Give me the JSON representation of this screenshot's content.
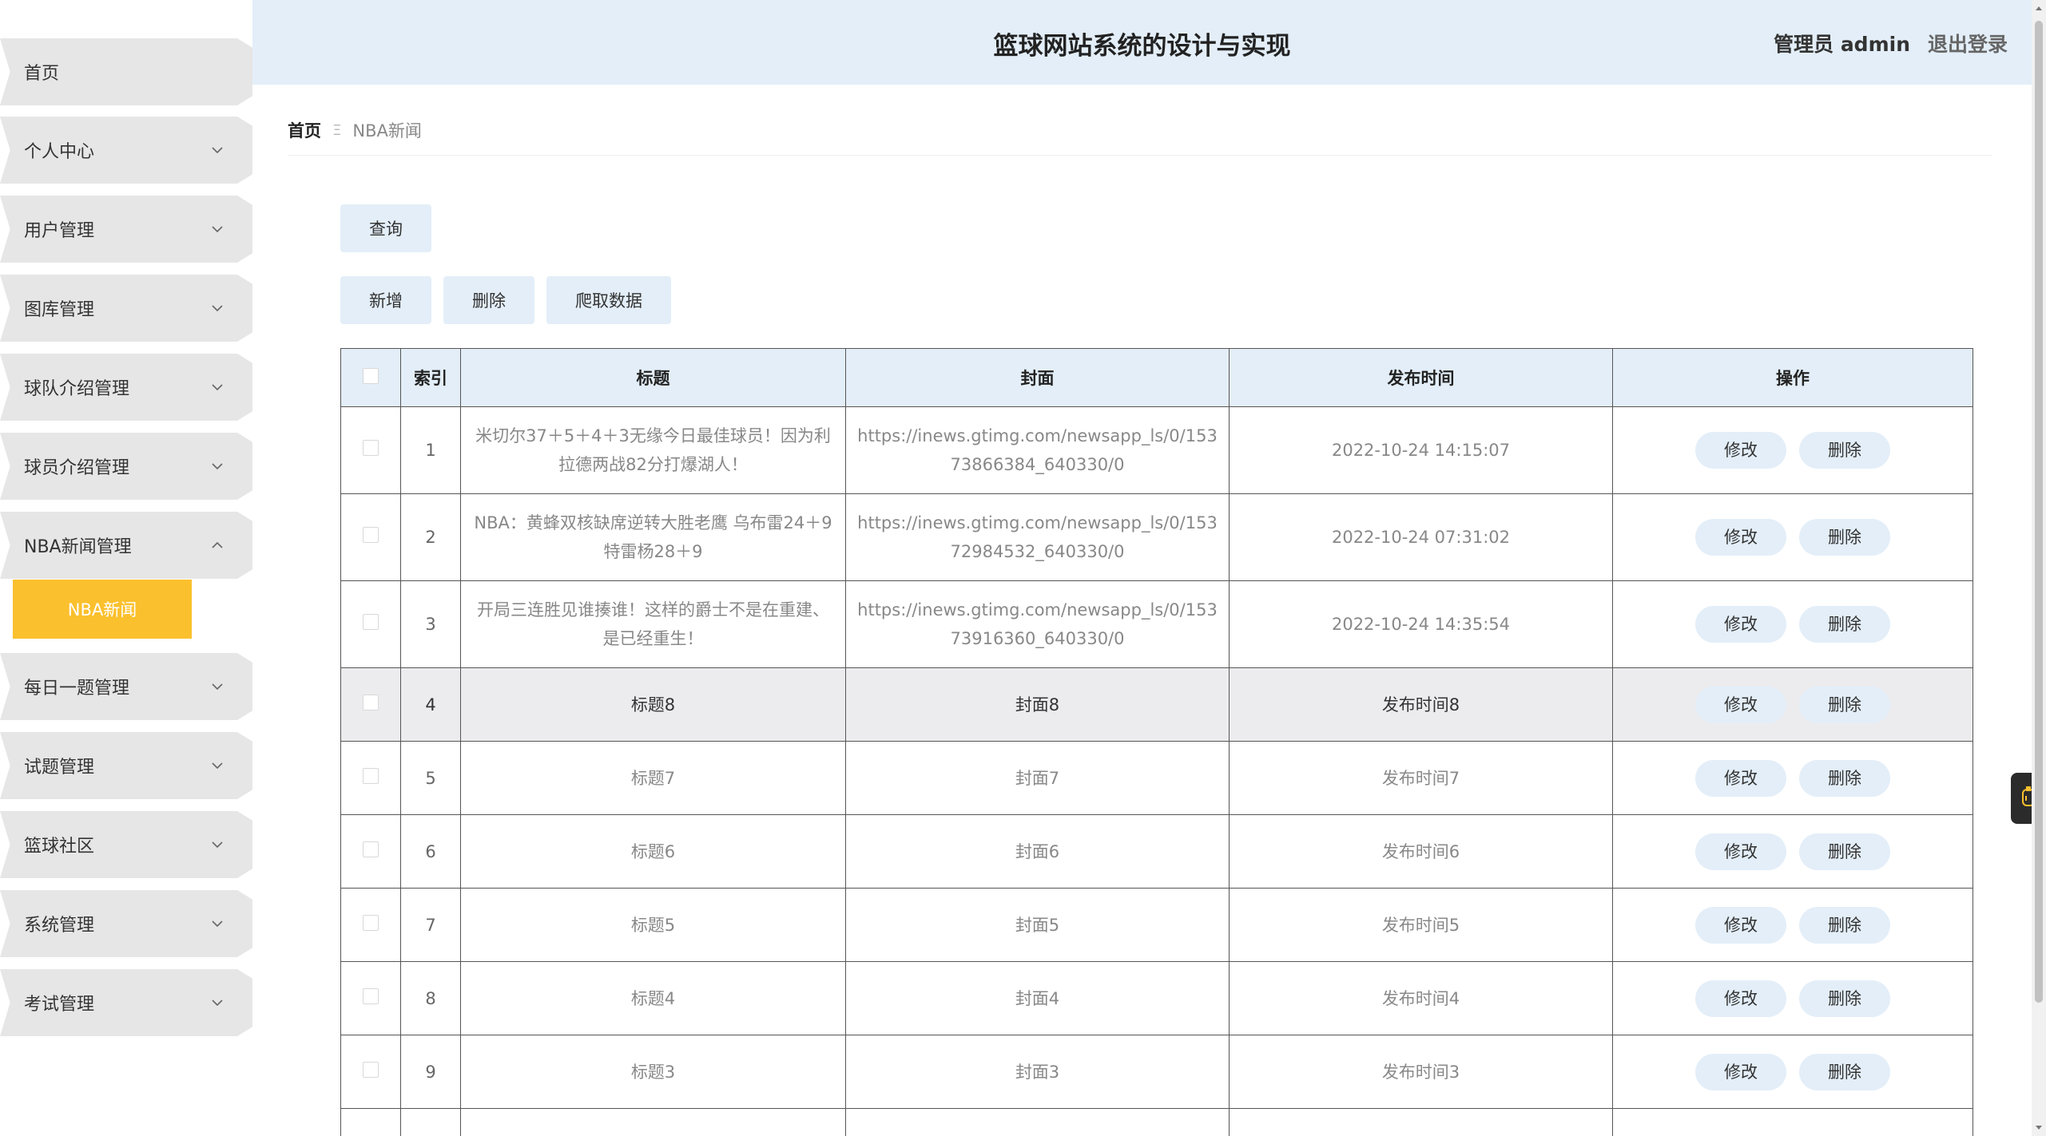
{
  "header": {
    "title": "篮球网站系统的设计与实现",
    "user": "管理员 admin",
    "logout": "退出登录"
  },
  "sidebar": {
    "items": [
      {
        "label": "首页"
      },
      {
        "label": "个人中心"
      },
      {
        "label": "用户管理"
      },
      {
        "label": "图库管理"
      },
      {
        "label": "球队介绍管理"
      },
      {
        "label": "球员介绍管理"
      },
      {
        "label": "NBA新闻管理"
      },
      {
        "label": "每日一题管理"
      },
      {
        "label": "试题管理"
      },
      {
        "label": "篮球社区"
      },
      {
        "label": "系统管理"
      },
      {
        "label": "考试管理"
      }
    ],
    "active_sub": "NBA新闻",
    "active_color": "#fbc02d"
  },
  "breadcrumb": {
    "home": "首页",
    "separator": "Ξ",
    "current": "NBA新闻"
  },
  "toolbar": {
    "query": "查询",
    "add": "新增",
    "delete": "删除",
    "crawl": "爬取数据"
  },
  "table": {
    "headers": {
      "index": "索引",
      "title": "标题",
      "cover": "封面",
      "time": "发布时间",
      "ops": "操作"
    },
    "edit_label": "修改",
    "delete_label": "删除",
    "rows": [
      {
        "index": "1",
        "title": "米切尔37＋5＋4＋3无缘今日最佳球员！因为利拉德两战82分打爆湖人！",
        "cover": "https://inews.gtimg.com/newsapp_ls/0/15373866384_640330/0",
        "time": "2022-10-24 14:15:07"
      },
      {
        "index": "2",
        "title": "NBA：黄蜂双核缺席逆转大胜老鹰 乌布雷24＋9 特雷杨28＋9",
        "cover": "https://inews.gtimg.com/newsapp_ls/0/15372984532_640330/0",
        "time": "2022-10-24 07:31:02"
      },
      {
        "index": "3",
        "title": "开局三连胜见谁揍谁！这样的爵士不是在重建、是已经重生！",
        "cover": "https://inews.gtimg.com/newsapp_ls/0/15373916360_640330/0",
        "time": "2022-10-24 14:35:54"
      },
      {
        "index": "4",
        "title": "标题8",
        "cover": "封面8",
        "time": "发布时间8"
      },
      {
        "index": "5",
        "title": "标题7",
        "cover": "封面7",
        "time": "发布时间7"
      },
      {
        "index": "6",
        "title": "标题6",
        "cover": "封面6",
        "time": "发布时间6"
      },
      {
        "index": "7",
        "title": "标题5",
        "cover": "封面5",
        "time": "发布时间5"
      },
      {
        "index": "8",
        "title": "标题4",
        "cover": "封面4",
        "time": "发布时间4"
      },
      {
        "index": "9",
        "title": "标题3",
        "cover": "封面3",
        "time": "发布时间3"
      }
    ]
  },
  "colors": {
    "header_bg": "#e3eef8",
    "button_bg": "#e3eef8",
    "sidebar_item_bg": "#e6e6e6",
    "accent": "#fbc02d"
  }
}
